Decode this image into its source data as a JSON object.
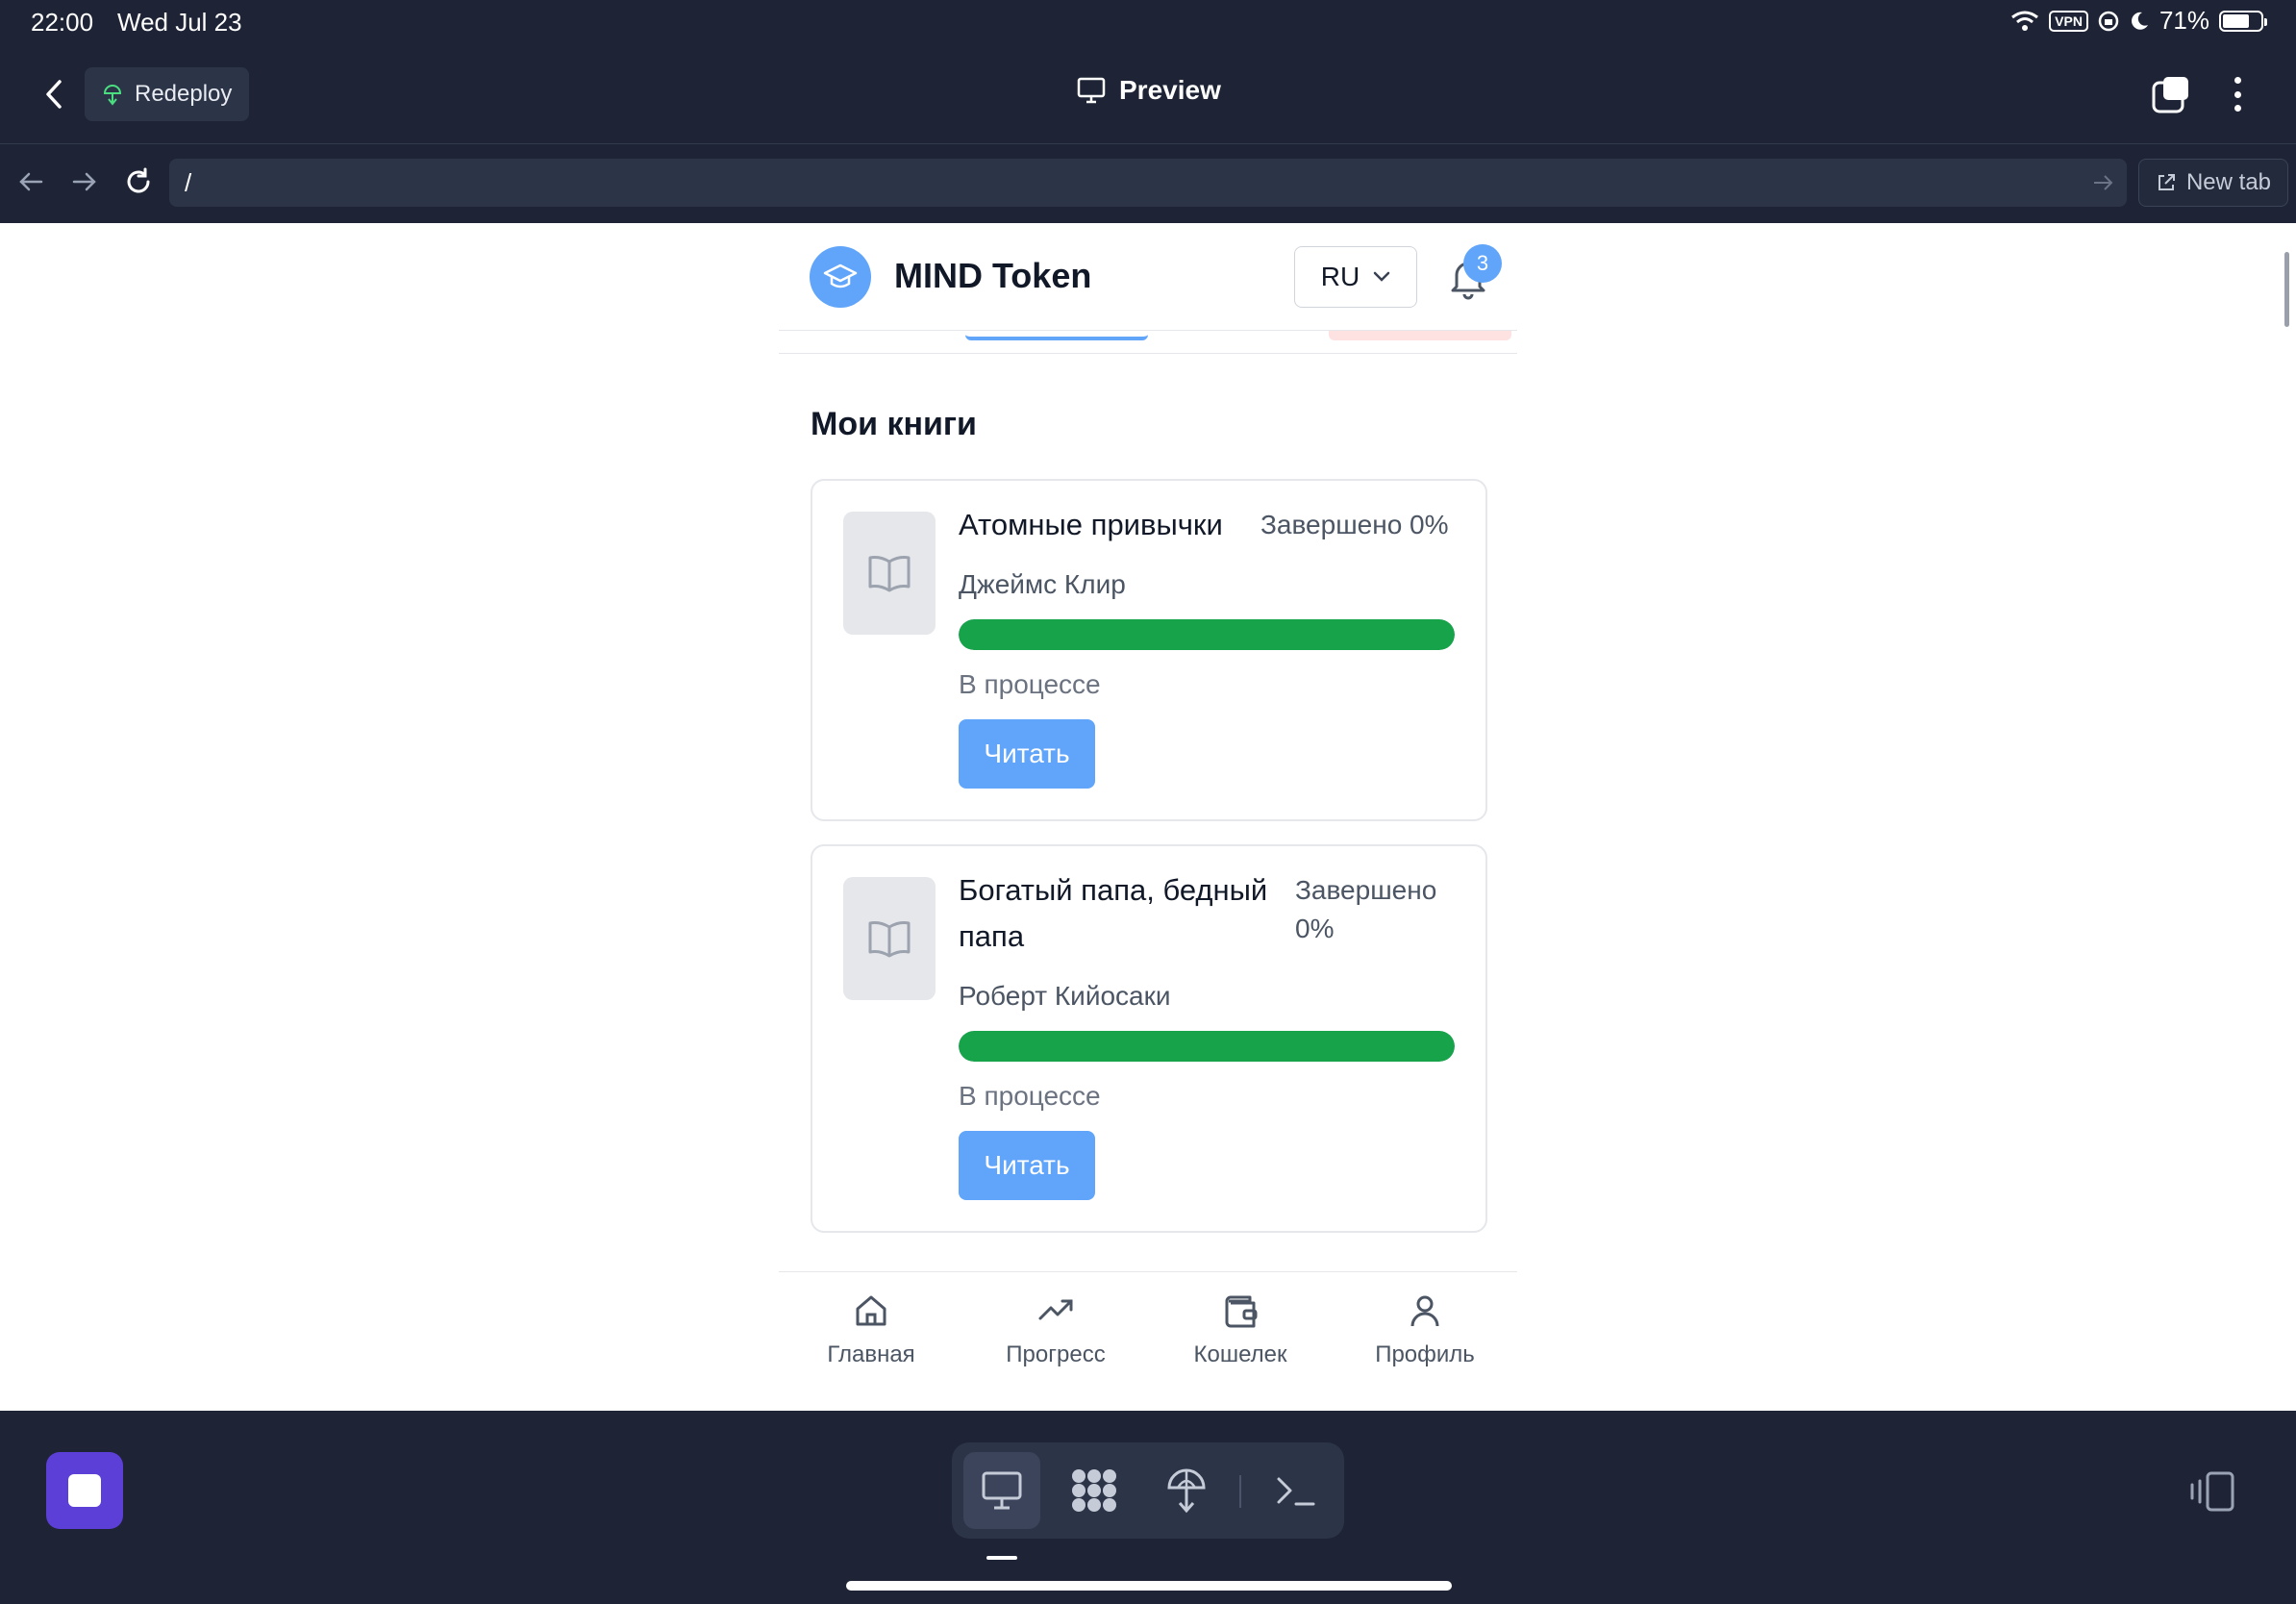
{
  "status_bar": {
    "time": "22:00",
    "date": "Wed Jul 23",
    "vpn_label": "VPN",
    "battery": "71%",
    "battery_level": 0.71
  },
  "toolbar": {
    "redeploy_label": "Redeploy",
    "title": "Preview"
  },
  "url_bar": {
    "url": "/",
    "new_tab_label": "New tab"
  },
  "app": {
    "title": "MIND Token",
    "language": "RU",
    "notification_count": "3",
    "section_title": "Мои книги",
    "books": [
      {
        "title": "Атомные привычки",
        "completion": "Завершено 0%",
        "author": "Джеймс Клир",
        "progress": 1.0,
        "status": "В процессе",
        "read_label": "Читать"
      },
      {
        "title": "Богатый папа, бедный папа",
        "completion": "Завершено 0%",
        "author": "Роберт Кийосаки",
        "progress": 1.0,
        "status": "В процессе",
        "read_label": "Читать"
      }
    ],
    "nav": [
      {
        "label": "Главная",
        "icon": "home-icon",
        "active": true
      },
      {
        "label": "Прогресс",
        "icon": "trending-up-icon",
        "active": false
      },
      {
        "label": "Кошелек",
        "icon": "wallet-icon",
        "active": false
      },
      {
        "label": "Профиль",
        "icon": "user-icon",
        "active": false
      }
    ]
  },
  "colors": {
    "accent": "#60a5fa",
    "progress": "#16a34a",
    "dock_stop": "#5b3fd6",
    "chrome_bg": "#1e2435"
  }
}
